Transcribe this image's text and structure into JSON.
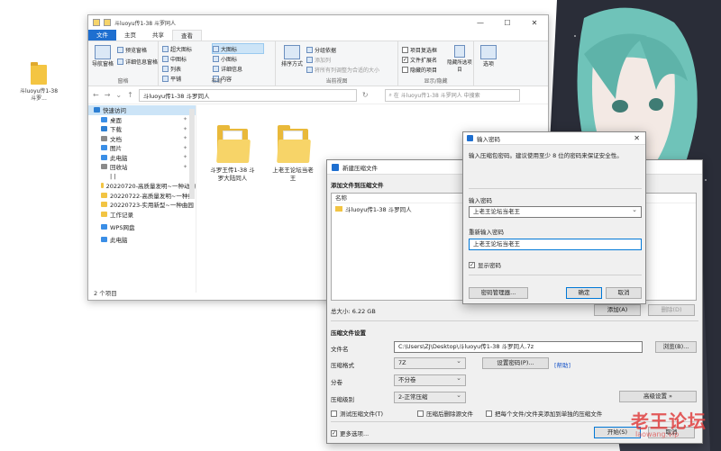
{
  "desktop": {
    "icon_label": "斗luoyu传1-38 斗罗..."
  },
  "explorer": {
    "title_path": "斗luoyu传1-38 斗罗同人",
    "window_controls": [
      "—",
      "☐",
      "✕"
    ],
    "tabs": [
      "文件",
      "主页",
      "共享",
      "查看"
    ],
    "ribbon": {
      "pane": {
        "nav_pane": "导航窗格",
        "preview": "预览窗格",
        "details": "详细信息窗格",
        "label": "窗格"
      },
      "layout": {
        "items": [
          "超大图标",
          "大图标",
          "中图标",
          "小图标",
          "列表",
          "详细信息",
          "平铺",
          "内容"
        ],
        "label": "布局"
      },
      "view": {
        "sort": "排序方式",
        "group": "分组依据",
        "add_col": "添加列",
        "fit_cols": "将所有列调整为合适的大小",
        "label": "当前视图"
      },
      "show": {
        "checkboxes": "项目复选框",
        "extensions": "文件扩展名",
        "hidden": "隐藏的项目",
        "hide_sel": "隐藏所选项目",
        "label": "显示/隐藏"
      },
      "options": "选项"
    },
    "address": "斗luoyu传1-38 斗罗同人",
    "search_placeholder": "在 斗luoyu传1-38 斗罗同人 中搜索",
    "sidebar": [
      {
        "label": "快速访问",
        "color": "#2d7fd3"
      },
      {
        "label": "桌面",
        "color": "#3a8ee6"
      },
      {
        "label": "下载",
        "color": "#2d7fd3"
      },
      {
        "label": "文档",
        "color": "#8a8a8a"
      },
      {
        "label": "图片",
        "color": "#3a8ee6"
      },
      {
        "label": "此电脑",
        "color": "#3a8ee6"
      },
      {
        "label": "回收站",
        "color": "#8a8a8a"
      },
      {
        "label": "| |",
        "color": "#ffffff"
      },
      {
        "label": "20220720-高质量发明~一种动物",
        "color": "#f2c443"
      },
      {
        "label": "20220722-高质量发明~一种组",
        "color": "#f2c443"
      },
      {
        "label": "20220723-实用新型~一种曲园",
        "color": "#f2c443"
      },
      {
        "label": "工作记录",
        "color": "#f2c443"
      },
      {
        "label": "WPS网盘",
        "color": "#3a8ee6"
      },
      {
        "label": "此电脑",
        "color": "#3a8ee6"
      }
    ],
    "files": [
      {
        "name": "斗罗王传1-38 斗罗大陆同人"
      },
      {
        "name": "上老王论坛当老王"
      }
    ],
    "status": "2 个项目"
  },
  "add_dialog": {
    "title": "新建压缩文件",
    "section_files": "添加文件到压缩文件",
    "col_name": "名称",
    "file_row": "斗luoyu传1-38 斗罗同人",
    "total": "总大小: 6.22 GB",
    "btn_add": "添加(A)",
    "btn_remove": "删除(D)",
    "section_settings": "压缩文件设置",
    "filename_label": "文件名",
    "filename_value": "C:\\Users\\ZJ\\Desktop\\斗luoyu传1-38 斗罗同人.7z",
    "browse": "浏览(B)...",
    "format_label": "压缩格式",
    "format_value": "7Z",
    "set_password": "设置密码(P)...",
    "help": "[帮助]",
    "split_label": "分卷",
    "split_value": "不分卷",
    "level_label": "压缩级别",
    "level_value": "2-正常压缩",
    "advanced": "高级设置 »",
    "cb_test": "测试压缩文件(T)",
    "cb_delete": "压缩后删除源文件",
    "cb_each": "把每个文件/文件夹添加到单独的压缩文件",
    "more": "更多选项...",
    "start": "开始(S)",
    "cancel": "取消"
  },
  "password_dialog": {
    "title": "输入密码",
    "tip": "输入压缩包密码。建议使用至少 8 位的密码来保证安全性。",
    "enter_label": "输入密码",
    "enter_value": "上老王论坛当老王",
    "reenter_label": "重新输入密码",
    "reenter_value": "上老王论坛当老王",
    "show_pw": "显示密码",
    "manager": "密码管理器...",
    "ok": "确定",
    "cancel": "取消"
  },
  "watermark": {
    "text": "老王论坛",
    "sub": "laowang.vip"
  }
}
